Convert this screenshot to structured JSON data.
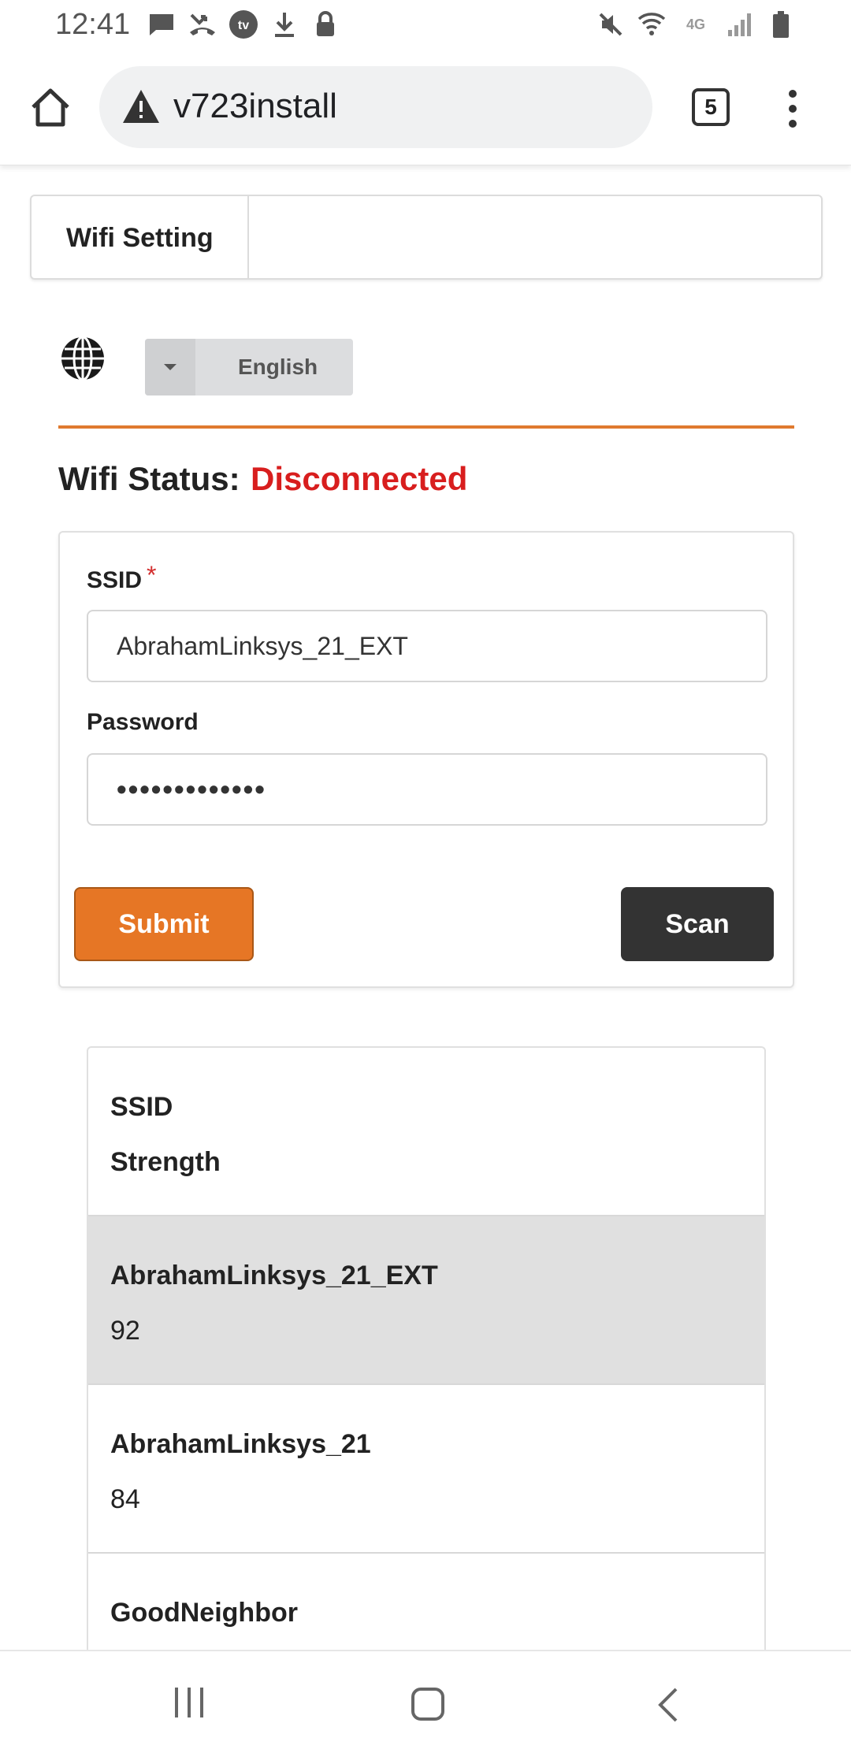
{
  "status_bar": {
    "time": "12:41",
    "left_icons": [
      "chat-icon",
      "missed-call-icon",
      "tv-icon",
      "download-icon",
      "lock-icon"
    ],
    "right_icons": [
      "mute-icon",
      "wifi-icon",
      "lte-icon",
      "signal-icon",
      "battery-icon"
    ],
    "network_label": "4G"
  },
  "browser": {
    "url": "v723install",
    "tab_count": "5"
  },
  "header": {
    "title": "Wifi Setting"
  },
  "language": {
    "selected": "English"
  },
  "wifi_status": {
    "label": "Wifi Status:",
    "value": "Disconnected",
    "value_color": "#d81e1e"
  },
  "form": {
    "ssid_label": "SSID",
    "required_marker": "*",
    "ssid_value": "AbrahamLinksys_21_EXT",
    "password_label": "Password",
    "password_value": "•••••••••••••",
    "submit_label": "Submit",
    "scan_label": "Scan"
  },
  "scan_table": {
    "header": {
      "ssid": "SSID",
      "strength": "Strength"
    },
    "rows": [
      {
        "ssid": "AbrahamLinksys_21_EXT",
        "strength": "92",
        "selected": true
      },
      {
        "ssid": "AbrahamLinksys_21",
        "strength": "84",
        "selected": false
      },
      {
        "ssid": "GoodNeighbor",
        "strength": "",
        "selected": false
      }
    ]
  },
  "colors": {
    "accent": "#e67625",
    "scan_button": "#333333",
    "selected_row": "#e0e0e0"
  }
}
